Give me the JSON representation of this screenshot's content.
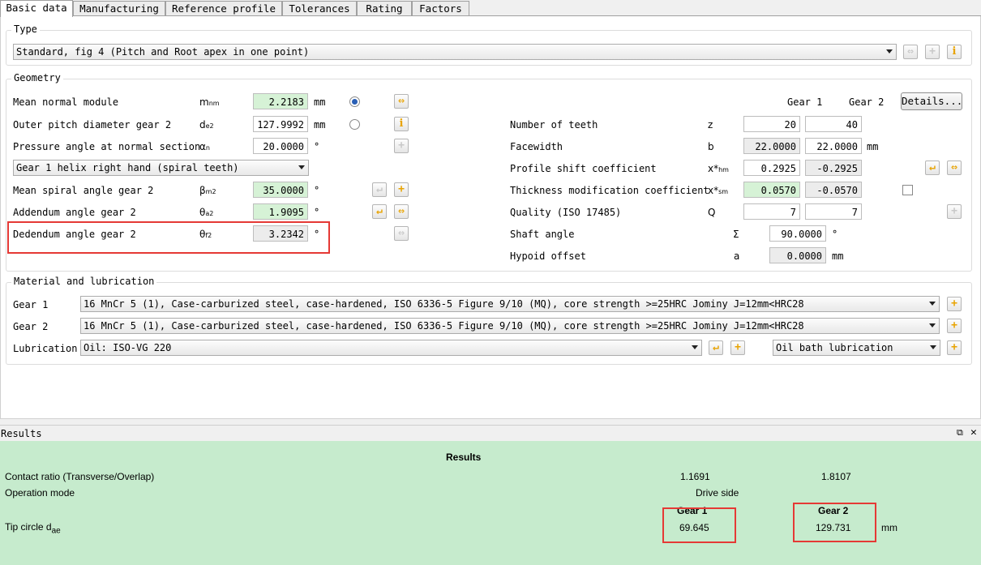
{
  "tabs": [
    "Basic data",
    "Manufacturing",
    "Reference profile",
    "Tolerances",
    "Rating",
    "Factors"
  ],
  "type": {
    "group_title": "Type",
    "selected": "Standard, fig 4 (Pitch and Root apex in one point)"
  },
  "geometry": {
    "group_title": "Geometry",
    "mean_normal_module": {
      "label": "Mean normal module",
      "value": "2.2183",
      "unit": "mm"
    },
    "outer_pitch_diameter": {
      "label": "Outer pitch diameter gear 2",
      "value": "127.9992",
      "unit": "mm"
    },
    "pressure_angle": {
      "label": "Pressure angle at normal section",
      "value": "20.0000",
      "unit": "°"
    },
    "helix_select": "Gear 1 helix right hand (spiral teeth)",
    "mean_spiral_angle": {
      "label": "Mean spiral angle gear 2",
      "value": "35.0000",
      "unit": "°"
    },
    "addendum_angle": {
      "label": "Addendum angle gear 2",
      "value": "1.9095",
      "unit": "°"
    },
    "dedendum_angle": {
      "label": "Dedendum angle gear 2",
      "value": "3.2342",
      "unit": "°"
    },
    "gear1_header": "Gear 1",
    "gear2_header": "Gear 2",
    "details_button": "Details...",
    "number_of_teeth": {
      "label": "Number of teeth",
      "symbol": "z",
      "gear1": "20",
      "gear2": "40"
    },
    "facewidth": {
      "label": "Facewidth",
      "symbol": "b",
      "gear1": "22.0000",
      "gear2": "22.0000",
      "unit": "mm"
    },
    "profile_shift": {
      "label": "Profile shift coefficient",
      "gear1": "0.2925",
      "gear2": "-0.2925"
    },
    "thickness_mod": {
      "label": "Thickness modification coefficient",
      "gear1": "0.0570",
      "gear2": "-0.0570"
    },
    "quality": {
      "label": "Quality (ISO 17485)",
      "symbol": "Q",
      "gear1": "7",
      "gear2": "7"
    },
    "shaft_angle": {
      "label": "Shaft angle",
      "symbol": "Σ",
      "value": "90.0000",
      "unit": "°"
    },
    "hypoid_offset": {
      "label": "Hypoid offset",
      "symbol": "a",
      "value": "0.0000",
      "unit": "mm"
    }
  },
  "material": {
    "group_title": "Material and lubrication",
    "gear1_label": "Gear 1",
    "gear1_value": "16 MnCr 5 (1), Case-carburized steel, case-hardened, ISO 6336-5 Figure 9/10 (MQ), core strength >=25HRC Jominy J=12mm<HRC28",
    "gear2_label": "Gear 2",
    "gear2_value": "16 MnCr 5 (1), Case-carburized steel, case-hardened, ISO 6336-5 Figure 9/10 (MQ), core strength >=25HRC Jominy J=12mm<HRC28",
    "lubrication_label": "Lubrication",
    "lubrication_value": "Oil: ISO-VG 220",
    "lubrication_type": "Oil bath lubrication"
  },
  "results": {
    "bar_title": "Results",
    "heading": "Results",
    "contact_ratio": {
      "label": "Contact ratio (Transverse/Overlap)",
      "v1": "1.1691",
      "v2": "1.8107"
    },
    "operation_mode": {
      "label": "Operation mode",
      "value": "Drive side"
    },
    "gear1_header": "Gear 1",
    "gear2_header": "Gear 2",
    "tip_circle": {
      "label": "Tip circle d",
      "sub": "ae",
      "gear1": "69.645",
      "gear2": "129.731",
      "unit": "mm"
    }
  },
  "colors": {
    "highlight": "#e53935",
    "green_field": "#d6f2d6",
    "results_bg": "#c6ebcd",
    "accent": "#e8a300"
  }
}
